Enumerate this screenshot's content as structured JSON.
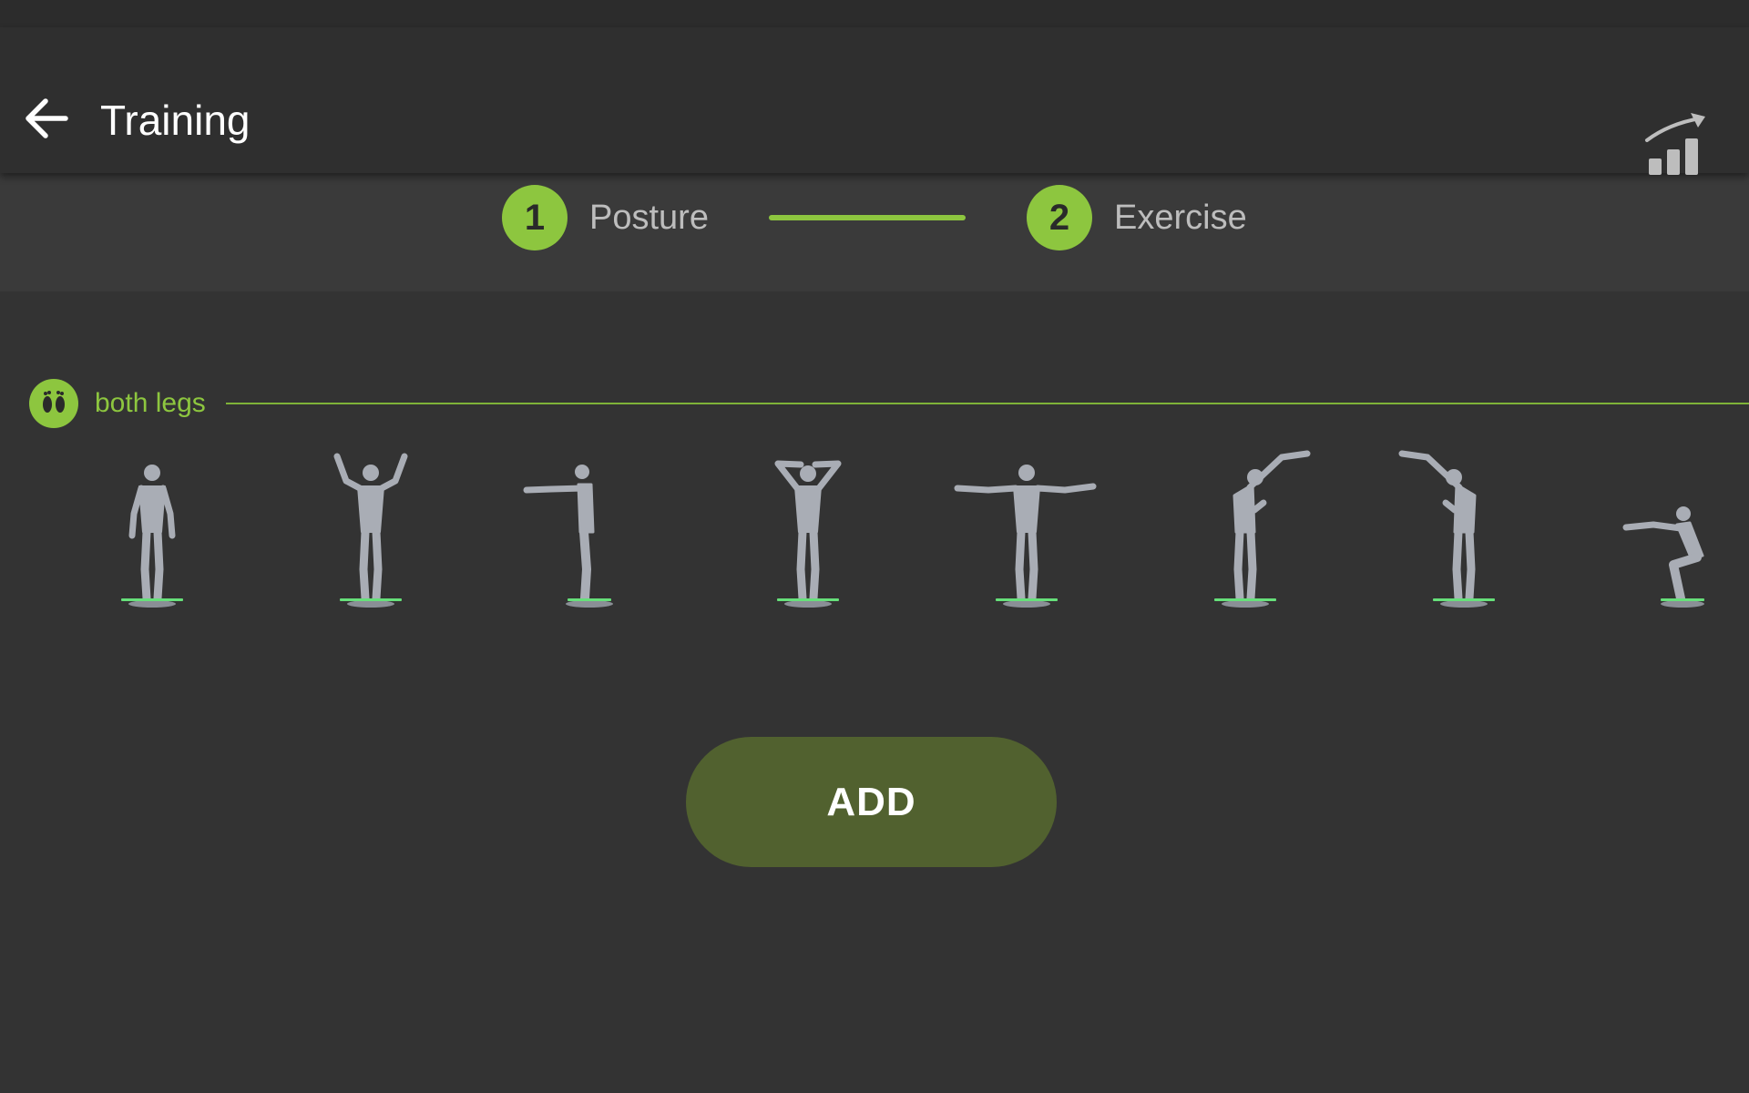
{
  "header": {
    "title": "Training",
    "back_icon": "arrow-left-icon",
    "stats_icon": "trending-bar-chart-icon"
  },
  "stepper": {
    "steps": [
      {
        "number": "1",
        "label": "Posture"
      },
      {
        "number": "2",
        "label": "Exercise"
      }
    ]
  },
  "section": {
    "label": "both legs",
    "icon": "feet-icon"
  },
  "postures": [
    {
      "name": "standing-neutral"
    },
    {
      "name": "arms-raised"
    },
    {
      "name": "arms-forward-side-view"
    },
    {
      "name": "hands-behind-head"
    },
    {
      "name": "arms-outstretched"
    },
    {
      "name": "side-bend-right"
    },
    {
      "name": "side-bend-left"
    },
    {
      "name": "squat"
    }
  ],
  "actions": {
    "add_label": "ADD"
  },
  "colors": {
    "accent": "#8dc63f",
    "background": "#333333",
    "appbar": "#2f2f2f",
    "stepper_bg": "#3a3a3a",
    "add_button": "#51612f",
    "figure": "#a9adb5",
    "platform": "#66e07a"
  }
}
